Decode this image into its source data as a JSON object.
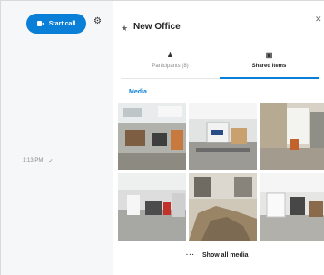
{
  "left": {
    "start_call_label": "Start call",
    "settings_icon": "gear-icon",
    "message": {
      "time": "1:13 PM",
      "status": "✓"
    }
  },
  "panel": {
    "title": "New Office",
    "tabs": [
      {
        "label": "Participants (8)",
        "icon": "participants-icon",
        "active": false
      },
      {
        "label": "Shared items",
        "icon": "gallery-icon",
        "active": true
      }
    ],
    "section_label": "Media",
    "show_all_label": "Show all media"
  },
  "colors": {
    "accent": "#0a7fd8",
    "left_bg": "#f6f7f8"
  }
}
